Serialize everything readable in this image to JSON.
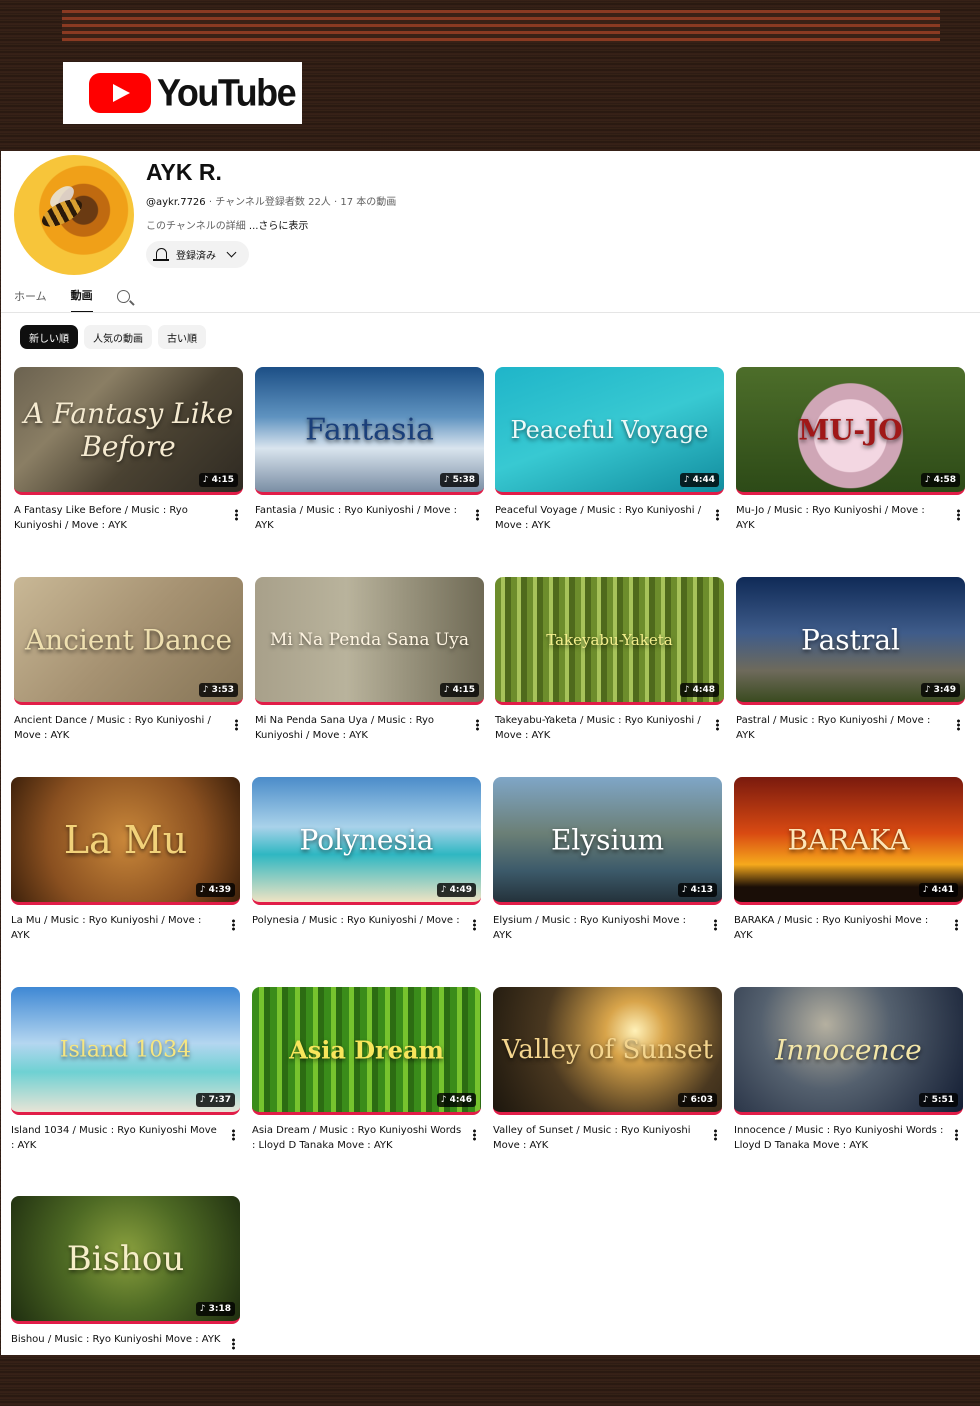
{
  "brand": {
    "logo_text": "YouTube"
  },
  "channel": {
    "name": "AYK R.",
    "handle": "@aykr.7726",
    "stats": " · チャンネル登録者数 22人 · 17 本の動画",
    "description": "このチャンネルの詳細 ",
    "more": "...さらに表示",
    "subscribe_label": "登録済み"
  },
  "tabs": [
    "ホーム",
    "動画"
  ],
  "chips": [
    "新しい順",
    "人気の動画",
    "古い順"
  ],
  "videos": [
    {
      "thumb_title": "A Fantasy Like Before",
      "duration": "4:15",
      "title": "A Fantasy Like Before / Music : Ryo Kuniyoshi / Move : AYK"
    },
    {
      "thumb_title": "Fantasia",
      "duration": "5:38",
      "title": "Fantasia / Music : Ryo Kuniyoshi / Move : AYK"
    },
    {
      "thumb_title": "Peaceful Voyage",
      "duration": "4:44",
      "title": "Peaceful Voyage / Music : Ryo Kuniyoshi / Move : AYK"
    },
    {
      "thumb_title": "MU-JO",
      "duration": "4:58",
      "title": "Mu-Jo / Music : Ryo Kuniyoshi / Move : AYK"
    },
    {
      "thumb_title": "Ancient Dance",
      "duration": "3:53",
      "title": "Ancient Dance / Music : Ryo Kuniyoshi / Move : AYK"
    },
    {
      "thumb_title": "Mi Na Penda Sana Uya",
      "duration": "4:15",
      "title": "Mi Na Penda Sana Uya / Music : Ryo Kuniyoshi / Move : AYK"
    },
    {
      "thumb_title": "Takeyabu-Yaketa",
      "duration": "4:48",
      "title": "Takeyabu-Yaketa / Music : Ryo Kuniyoshi / Move : AYK"
    },
    {
      "thumb_title": "Pastral",
      "duration": "3:49",
      "title": "Pastral / Music : Ryo Kuniyoshi / Move : AYK"
    },
    {
      "thumb_title": "La Mu",
      "duration": "4:39",
      "title": "La Mu / Music : Ryo Kuniyoshi / Move : AYK"
    },
    {
      "thumb_title": "Polynesia",
      "duration": "4:49",
      "title": "Polynesia / Music : Ryo Kuniyoshi / Move :"
    },
    {
      "thumb_title": "Elysium",
      "duration": "4:13",
      "title": "Elysium / Music : Ryo Kuniyoshi Move : AYK"
    },
    {
      "thumb_title": "BARAKA",
      "duration": "4:41",
      "title": "BARAKA / Music : Ryo Kuniyoshi Move : AYK"
    },
    {
      "thumb_title": "Island 1034",
      "duration": "7:37",
      "title": "Island 1034 / Music : Ryo Kuniyoshi Move : AYK"
    },
    {
      "thumb_title": "Asia Dream",
      "duration": "4:46",
      "title": "Asia Dream / Music : Ryo Kuniyoshi    Words : Lloyd D Tanaka Move : AYK"
    },
    {
      "thumb_title": "Valley of Sunset",
      "duration": "6:03",
      "title": "Valley of Sunset / Music : Ryo Kuniyoshi Move : AYK"
    },
    {
      "thumb_title": "Innocence",
      "duration": "5:51",
      "title": "Innocence / Music : Ryo Kuniyoshi    Words : Lloyd D Tanaka Move : AYK"
    },
    {
      "thumb_title": "Bishou",
      "duration": "3:18",
      "title": "Bishou / Music : Ryo Kuniyoshi Move : AYK"
    }
  ]
}
